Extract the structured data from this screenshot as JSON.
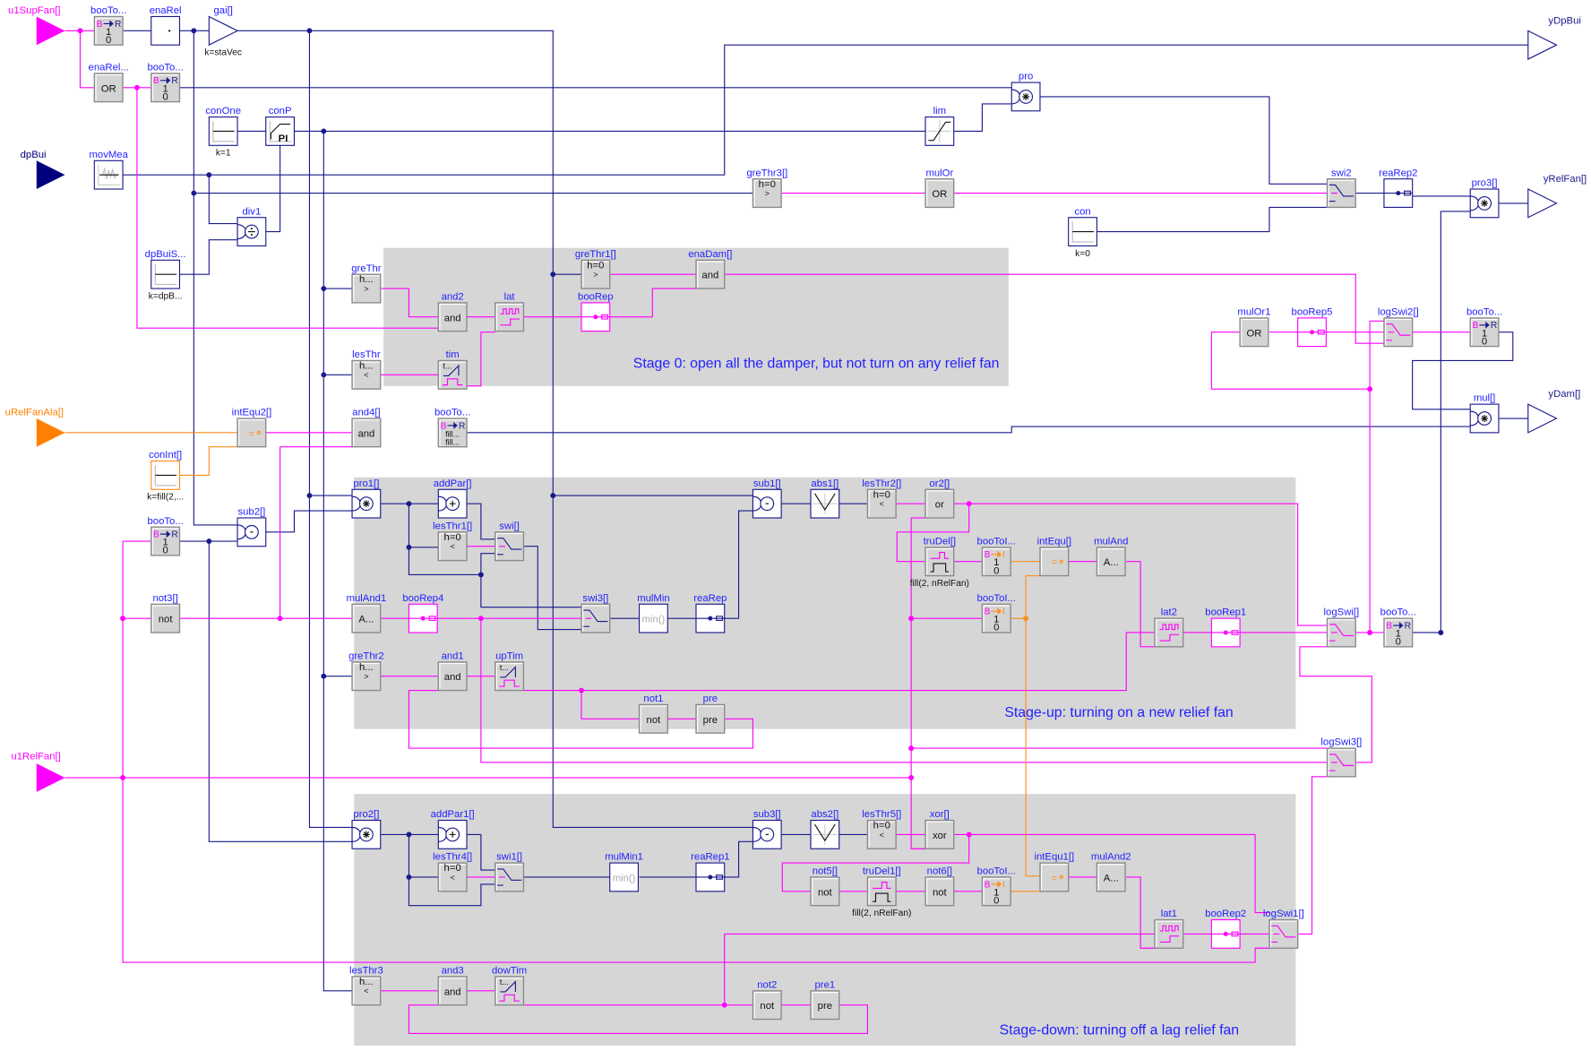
{
  "colors": {
    "real": "#1a1a8c",
    "boolean": "#ff00ff",
    "integer": "#ff8c1a",
    "label": "#1f1fff",
    "region": "#d6d6d6"
  },
  "inputs": {
    "u1SupFan": {
      "label": "u1SupFan[]",
      "color": "#ff00ff"
    },
    "dpBui": {
      "label": "dpBui",
      "color": "#00007f"
    },
    "uRelFanAla": {
      "label": "uRelFanAla[]",
      "color": "#ff8000"
    },
    "u1RelFan": {
      "label": "u1RelFan[]",
      "color": "#ff00ff"
    }
  },
  "outputs": {
    "yDpBui": {
      "label": "yDpBui"
    },
    "yRelFan": {
      "label": "yRelFan[]"
    },
    "yDam": {
      "label": "yDam[]"
    }
  },
  "annotations": {
    "stage0": "Stage 0: open all the damper, but not turn on any relief fan",
    "stageUp": "Stage-up: turning on a new relief fan",
    "stageDown": "Stage-down: turning off a lag relief fan"
  },
  "blocks": {
    "booTo1": {
      "label": "booTo...",
      "icon": "boolean-to-real",
      "glyph": [
        "B",
        "R"
      ],
      "text": [
        "1",
        "0"
      ]
    },
    "enaRel": {
      "label": "enaRel",
      "icon": "multi-or"
    },
    "gai": {
      "label": "gai[]",
      "icon": "gain",
      "param": "k=staVec"
    },
    "enaRelOr": {
      "label": "enaRel...",
      "text": [
        "OR"
      ]
    },
    "booTo2": {
      "label": "booTo...",
      "icon": "boolean-to-real",
      "glyph": [
        "B",
        "R"
      ],
      "text": [
        "1",
        "0"
      ]
    },
    "conOne": {
      "label": "conOne",
      "icon": "constant",
      "param": "k=1"
    },
    "conP": {
      "label": "conP",
      "icon": "pi-controller",
      "text": [
        "PI"
      ]
    },
    "movMea": {
      "label": "movMea",
      "icon": "moving-mean"
    },
    "div1": {
      "label": "div1",
      "icon": "divide"
    },
    "dpBuiS": {
      "label": "dpBuiS...",
      "icon": "constant",
      "param": "k=dpB..."
    },
    "pro": {
      "label": "pro",
      "icon": "product"
    },
    "lim": {
      "label": "lim",
      "icon": "limiter"
    },
    "greThr3": {
      "label": "greThr3[]",
      "text": [
        "h=0",
        ">"
      ]
    },
    "mulOr": {
      "label": "mulOr",
      "text": [
        "OR"
      ]
    },
    "swi2": {
      "label": "swi2",
      "icon": "switch"
    },
    "reaRep2": {
      "label": "reaRep2",
      "icon": "replicator"
    },
    "pro3": {
      "label": "pro3[]",
      "icon": "product"
    },
    "con": {
      "label": "con",
      "icon": "constant",
      "param": "k=0"
    },
    "greThr": {
      "label": "greThr",
      "text": [
        "h...",
        ">"
      ]
    },
    "and2": {
      "label": "and2",
      "text": [
        "and"
      ]
    },
    "lat": {
      "label": "lat",
      "icon": "latch"
    },
    "lesThr": {
      "label": "lesThr",
      "text": [
        "h...",
        "<"
      ]
    },
    "tim": {
      "label": "tim",
      "icon": "timer",
      "text": [
        "t..."
      ]
    },
    "greThr1": {
      "label": "greThr1[]",
      "text": [
        "h=0",
        ">"
      ]
    },
    "booRep": {
      "label": "booRep",
      "icon": "replicator"
    },
    "enaDam": {
      "label": "enaDam[]",
      "text": [
        "and"
      ]
    },
    "mulOr1": {
      "label": "mulOr1",
      "text": [
        "OR"
      ]
    },
    "booRep5": {
      "label": "booRep5",
      "icon": "replicator"
    },
    "logSwi2": {
      "label": "logSwi2[]",
      "icon": "logical-switch"
    },
    "booTo3": {
      "label": "booTo...",
      "icon": "boolean-to-real",
      "glyph": [
        "B",
        "R"
      ],
      "text": [
        "1",
        "0"
      ]
    },
    "mul": {
      "label": "mul[]",
      "icon": "product"
    },
    "intEqu2": {
      "label": "intEqu2[]",
      "icon": "integer-equal",
      "glyph": [
        "="
      ]
    },
    "and4": {
      "label": "and4[]",
      "text": [
        "and"
      ]
    },
    "booToFill": {
      "label": "booTo...",
      "icon": "boolean-to-real",
      "glyph": [
        "B",
        "R"
      ],
      "text": [
        "fill...",
        "fill..."
      ]
    },
    "conInt": {
      "label": "conInt[]",
      "icon": "constant",
      "param": "k=fill(2,..."
    },
    "pro1": {
      "label": "pro1[]",
      "icon": "product"
    },
    "addPar": {
      "label": "addPar[]",
      "icon": "add"
    },
    "lesThr1": {
      "label": "lesThr1[]",
      "text": [
        "h=0",
        "<"
      ]
    },
    "swi": {
      "label": "swi[]",
      "icon": "switch"
    },
    "booTo4": {
      "label": "booTo...",
      "icon": "boolean-to-real",
      "glyph": [
        "B",
        "R"
      ],
      "text": [
        "1",
        "0"
      ]
    },
    "sub2": {
      "label": "sub2[]",
      "icon": "subtract"
    },
    "not3": {
      "label": "not3[]",
      "text": [
        "not"
      ]
    },
    "mulAnd1": {
      "label": "mulAnd1",
      "text": [
        "A..."
      ]
    },
    "booRep4": {
      "label": "booRep4",
      "icon": "replicator"
    },
    "swi3": {
      "label": "swi3[]",
      "icon": "switch"
    },
    "mulMin": {
      "label": "mulMin",
      "text": [
        "min()"
      ]
    },
    "reaRep": {
      "label": "reaRep",
      "icon": "replicator"
    },
    "sub1": {
      "label": "sub1[]",
      "icon": "subtract"
    },
    "abs1": {
      "label": "abs1[]",
      "icon": "absolute"
    },
    "lesThr2": {
      "label": "lesThr2[]",
      "text": [
        "h=0",
        "<"
      ]
    },
    "or2": {
      "label": "or2[]",
      "text": [
        "or"
      ]
    },
    "truDel": {
      "label": "truDel[]",
      "icon": "true-delay",
      "param": "fill(2, nRelFan)"
    },
    "booToI1": {
      "label": "booToI...",
      "icon": "boolean-to-integer",
      "glyph": [
        "B",
        "I"
      ],
      "text": [
        "1",
        "0"
      ]
    },
    "intEqu": {
      "label": "intEqu[]",
      "icon": "integer-equal",
      "glyph": [
        "="
      ]
    },
    "mulAnd": {
      "label": "mulAnd",
      "text": [
        "A..."
      ]
    },
    "booToI2": {
      "label": "booToI...",
      "icon": "boolean-to-integer",
      "glyph": [
        "B",
        "I"
      ],
      "text": [
        "1",
        "0"
      ]
    },
    "lat2": {
      "label": "lat2",
      "icon": "latch"
    },
    "booRep1": {
      "label": "booRep1",
      "icon": "replicator"
    },
    "logSwi": {
      "label": "logSwi[]",
      "icon": "logical-switch"
    },
    "booTo5": {
      "label": "booTo...",
      "icon": "boolean-to-real",
      "glyph": [
        "B",
        "R"
      ],
      "text": [
        "1",
        "0"
      ]
    },
    "greThr2": {
      "label": "greThr2",
      "text": [
        "h...",
        ">"
      ]
    },
    "and1": {
      "label": "and1",
      "text": [
        "and"
      ]
    },
    "upTim": {
      "label": "upTim",
      "icon": "timer",
      "text": [
        "t..."
      ]
    },
    "not1": {
      "label": "not1",
      "text": [
        "not"
      ]
    },
    "pre": {
      "label": "pre",
      "text": [
        "pre"
      ]
    },
    "logSwi3": {
      "label": "logSwi3[]",
      "icon": "logical-switch"
    },
    "pro2": {
      "label": "pro2[]",
      "icon": "product"
    },
    "addPar1": {
      "label": "addPar1[]",
      "icon": "add"
    },
    "lesThr4": {
      "label": "lesThr4[]",
      "text": [
        "h=0",
        "<"
      ]
    },
    "swi1": {
      "label": "swi1[]",
      "icon": "switch"
    },
    "mulMin1": {
      "label": "mulMin1",
      "text": [
        "min()"
      ]
    },
    "reaRep1": {
      "label": "reaRep1",
      "icon": "replicator"
    },
    "sub3": {
      "label": "sub3[]",
      "icon": "subtract"
    },
    "abs2": {
      "label": "abs2[]",
      "icon": "absolute"
    },
    "lesThr5": {
      "label": "lesThr5[]",
      "text": [
        "h=0",
        "<"
      ]
    },
    "xor": {
      "label": "xor[]",
      "text": [
        "xor"
      ]
    },
    "not5": {
      "label": "not5[]",
      "text": [
        "not"
      ]
    },
    "truDel1": {
      "label": "truDel1[]",
      "icon": "true-delay",
      "param": "fill(2, nRelFan)"
    },
    "not6": {
      "label": "not6[]",
      "text": [
        "not"
      ]
    },
    "booToI3": {
      "label": "booToI...",
      "icon": "boolean-to-integer",
      "glyph": [
        "B",
        "I"
      ],
      "text": [
        "1",
        "0"
      ]
    },
    "intEqu1": {
      "label": "intEqu1[]",
      "icon": "integer-equal",
      "glyph": [
        "="
      ]
    },
    "mulAnd2": {
      "label": "mulAnd2",
      "text": [
        "A..."
      ]
    },
    "lat1": {
      "label": "lat1",
      "icon": "latch"
    },
    "booRep2": {
      "label": "booRep2",
      "icon": "replicator"
    },
    "logSwi1": {
      "label": "logSwi1[]",
      "icon": "logical-switch"
    },
    "lesThr3": {
      "label": "lesThr3",
      "text": [
        "h...",
        "<"
      ]
    },
    "and3": {
      "label": "and3",
      "text": [
        "and"
      ]
    },
    "dowTim": {
      "label": "dowTim",
      "icon": "timer",
      "text": [
        "t..."
      ]
    },
    "not2": {
      "label": "not2",
      "text": [
        "not"
      ]
    },
    "pre1": {
      "label": "pre1",
      "text": [
        "pre"
      ]
    }
  }
}
